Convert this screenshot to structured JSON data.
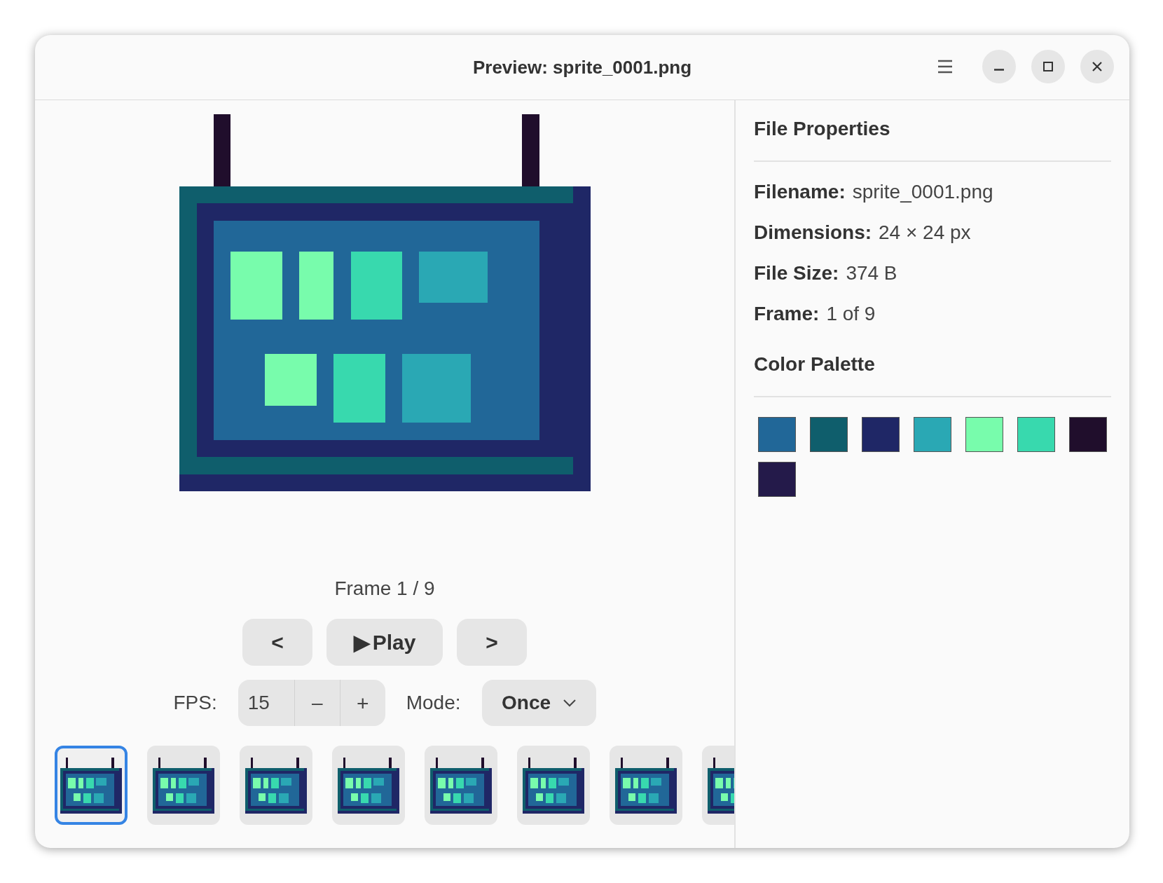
{
  "window": {
    "title": "Preview: sprite_0001.png"
  },
  "preview": {
    "kind": "picture",
    "frame_label": "Frame 1 / 9"
  },
  "playback": {
    "prev": "<",
    "play_icon": "▶",
    "play": "Play",
    "next": ">"
  },
  "fps": {
    "label": "FPS:",
    "value": "15",
    "decrement": "–",
    "increment": "+"
  },
  "mode": {
    "label": "Mode:",
    "value": "Once"
  },
  "thumbnails": [
    {
      "selected": true
    },
    {
      "selected": false
    },
    {
      "selected": false
    },
    {
      "selected": false
    },
    {
      "selected": false
    },
    {
      "selected": false
    },
    {
      "selected": false
    },
    {
      "selected": false
    }
  ],
  "properties": {
    "title": "File Properties",
    "rows": [
      {
        "label": "Filename:",
        "value": "sprite_0001.png"
      },
      {
        "label": "Dimensions:",
        "value": "24 × 24 px"
      },
      {
        "label": "File Size:",
        "value": "374 B"
      },
      {
        "label": "Frame:",
        "value": "1 of 9"
      }
    ],
    "palette_title": "Color Palette",
    "palette": [
      {
        "color": "#216798"
      },
      {
        "color": "#0f5e6c"
      },
      {
        "color": "#1f2766"
      },
      {
        "color": "#2aa8b4"
      },
      {
        "color": "#78fcac"
      },
      {
        "color": "#38d9ae"
      },
      {
        "color": "#200e2c"
      },
      {
        "color": "#241a4a"
      }
    ]
  }
}
